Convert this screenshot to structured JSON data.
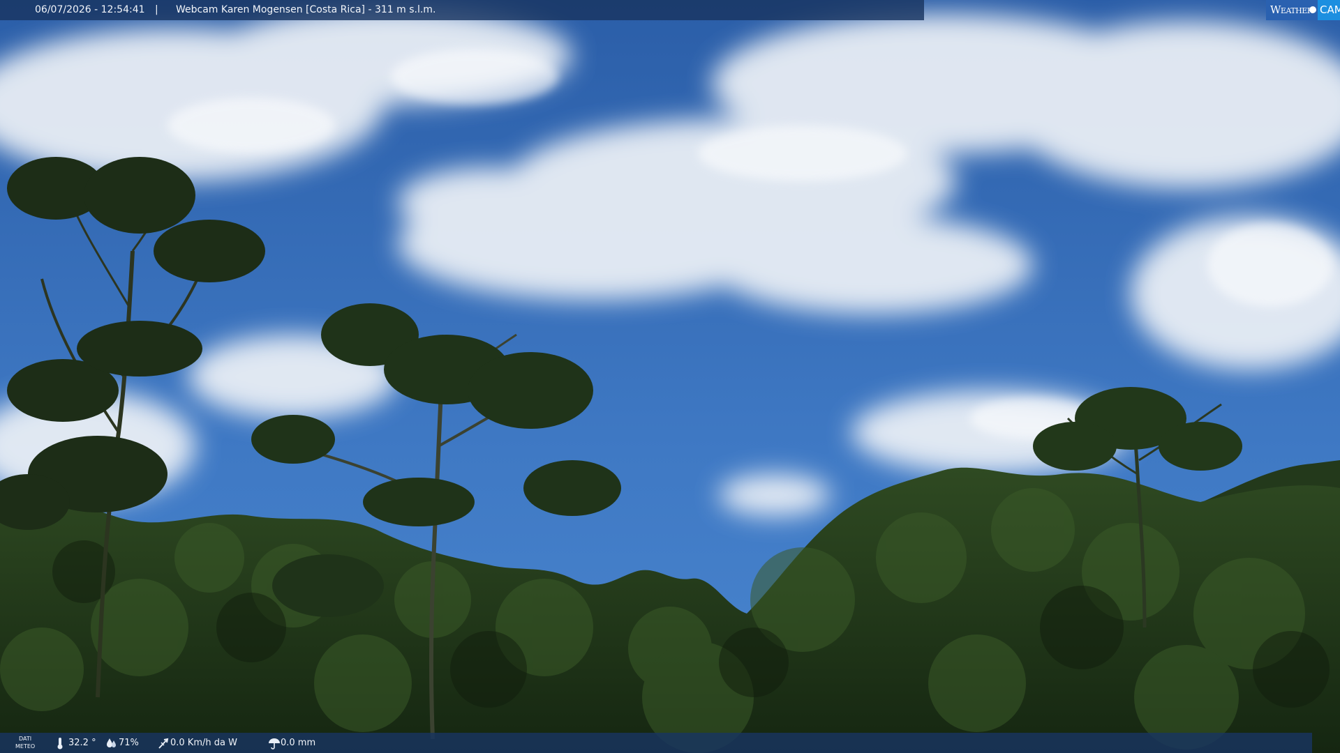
{
  "overlay": {
    "timestamp": "06/07/2026 - 12:54:41",
    "separator": "|",
    "title": "Webcam Karen Mogensen [Costa Rica] - 311 m s.l.m."
  },
  "logo": {
    "word1": "Weather",
    "word2": "CAM"
  },
  "meteo": {
    "label_line1": "DATI",
    "label_line2": "METEO",
    "temperature": "32.2 °",
    "humidity": "71%",
    "wind": "0.0 Km/h da W",
    "rain": "0.0 mm"
  },
  "colors": {
    "sky_top": "#2b5ea8",
    "sky_bottom": "#4a86cf",
    "foliage_dark": "#15260f",
    "foliage_mid": "#2e4a1f",
    "bar": "#183460"
  }
}
